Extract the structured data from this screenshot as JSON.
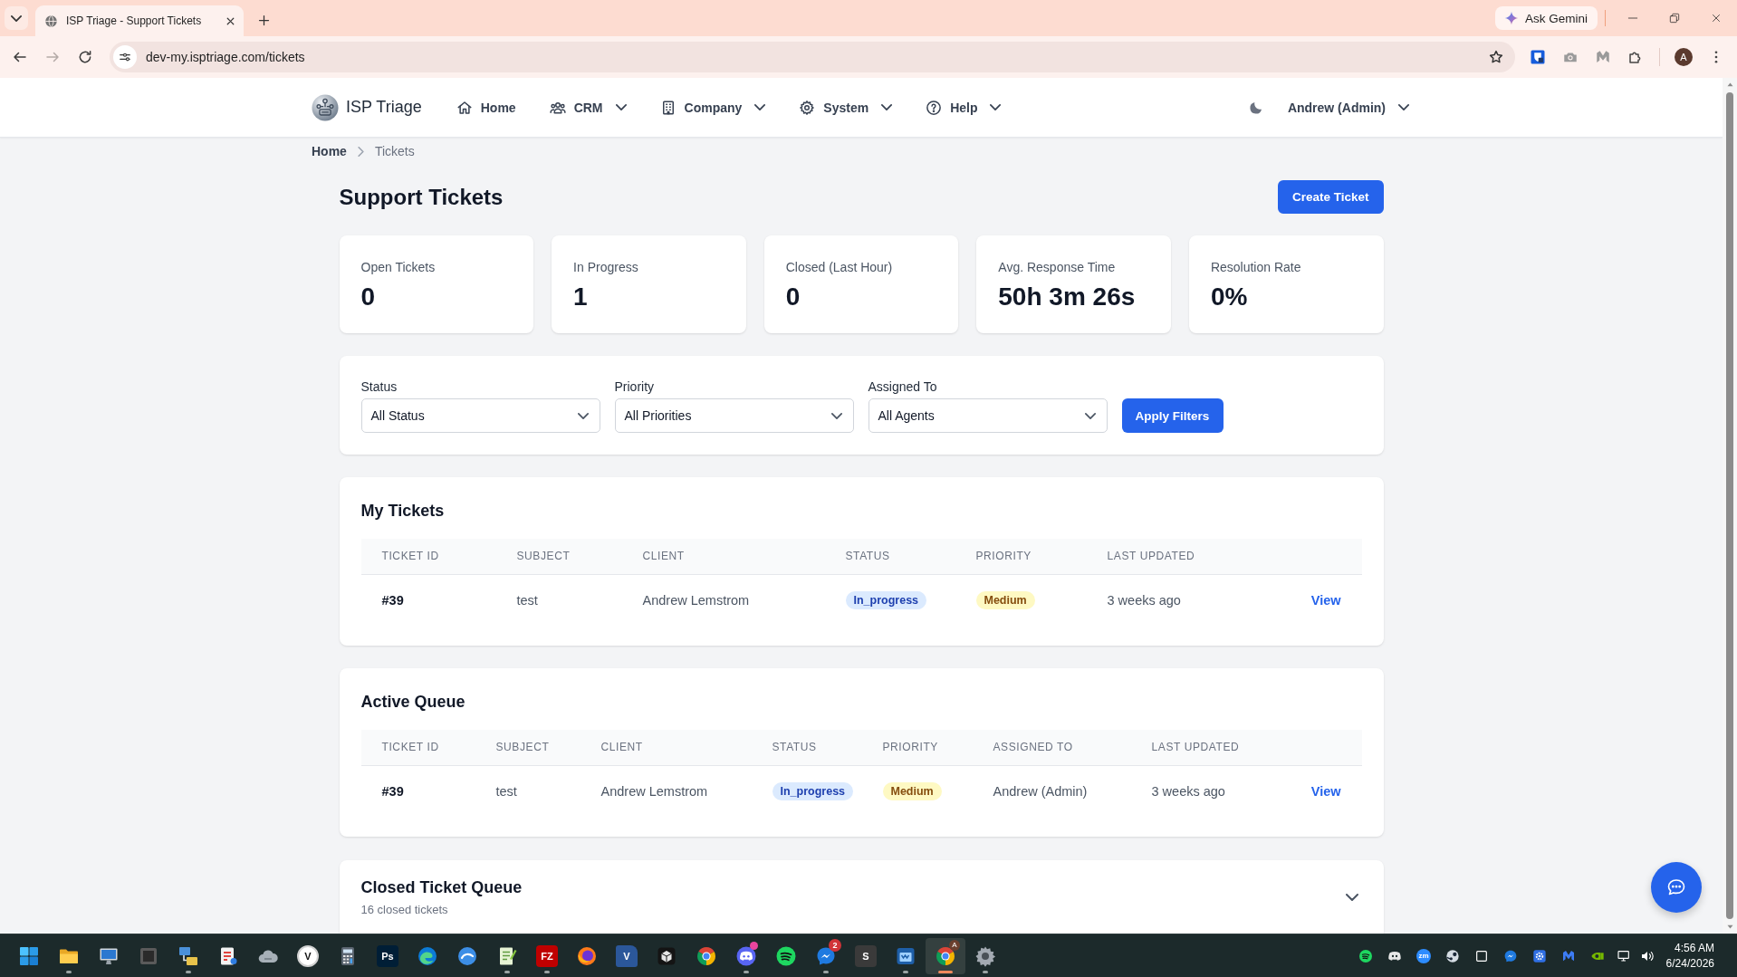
{
  "browser": {
    "tabs": [
      {
        "title": "ISP Triage - Support Tickets",
        "selected": true
      }
    ],
    "gemini_button": "Ask Gemini",
    "back_button": {
      "disabled": false
    },
    "forward_button": {
      "disabled": true
    },
    "url": "dev-my.isptriage.com/tickets",
    "profile_initial": "A"
  },
  "navbar": {
    "brand": "ISP Triage",
    "items": [
      {
        "label": "Home",
        "dropdown": false
      },
      {
        "label": "CRM",
        "dropdown": true
      },
      {
        "label": "Company",
        "dropdown": true
      },
      {
        "label": "System",
        "dropdown": true
      },
      {
        "label": "Help",
        "dropdown": true
      }
    ],
    "user": {
      "label": "Andrew (Admin)",
      "dropdown": true
    }
  },
  "breadcrumb": [
    {
      "label": "Home",
      "current": false
    },
    {
      "label": "Tickets",
      "current": true
    }
  ],
  "header": {
    "title": "Support Tickets",
    "button": "Create Ticket"
  },
  "stats": [
    {
      "label": "Open Tickets",
      "value": "0"
    },
    {
      "label": "In Progress",
      "value": "1"
    },
    {
      "label": "Closed (Last Hour)",
      "value": "0"
    },
    {
      "label": "Avg. Response Time",
      "value": "50h 3m 26s"
    },
    {
      "label": "Resolution Rate",
      "value": "0%"
    }
  ],
  "filters": {
    "fields": [
      {
        "label": "Status",
        "value": "All Status"
      },
      {
        "label": "Priority",
        "value": "All Priorities"
      },
      {
        "label": "Assigned To",
        "value": "All Agents"
      }
    ],
    "button": "Apply Filters"
  },
  "tables": [
    {
      "title": "My Tickets",
      "columns": [
        "TICKET ID",
        "SUBJECT",
        "CLIENT",
        "STATUS",
        "PRIORITY",
        "LAST UPDATED"
      ],
      "rows": [
        {
          "cells": [
            {
              "kind": "id",
              "text": "#39"
            },
            {
              "kind": "text",
              "text": "test"
            },
            {
              "kind": "text",
              "text": "Andrew Lemstrom"
            },
            {
              "kind": "info",
              "text": "In_progress"
            },
            {
              "kind": "warning",
              "text": "Medium"
            },
            {
              "kind": "text",
              "text": "3 weeks ago"
            },
            {
              "kind": "link",
              "text": "View"
            }
          ]
        }
      ]
    },
    {
      "title": "Active Queue",
      "columns": [
        "TICKET ID",
        "SUBJECT",
        "CLIENT",
        "STATUS",
        "PRIORITY",
        "ASSIGNED TO",
        "LAST UPDATED"
      ],
      "rows": [
        {
          "cells": [
            {
              "kind": "id",
              "text": "#39"
            },
            {
              "kind": "text",
              "text": "test"
            },
            {
              "kind": "text",
              "text": "Andrew Lemstrom"
            },
            {
              "kind": "info",
              "text": "In_progress"
            },
            {
              "kind": "warning",
              "text": "Medium"
            },
            {
              "kind": "text",
              "text": "Andrew (Admin)"
            },
            {
              "kind": "text",
              "text": "3 weeks ago"
            },
            {
              "kind": "link",
              "text": "View"
            }
          ]
        }
      ]
    }
  ],
  "closed_queue": {
    "title": "Closed Ticket Queue",
    "subtitle": "16 closed tickets",
    "expanded": false
  },
  "taskbar": {
    "apps": [
      {
        "kind": "start",
        "running": false,
        "selected": false
      },
      {
        "kind": "folder",
        "running": true,
        "selected": false
      },
      {
        "kind": "monitor",
        "running": false,
        "selected": false
      },
      {
        "kind": "square",
        "running": false,
        "selected": false
      },
      {
        "kind": "network",
        "running": true,
        "selected": false
      },
      {
        "kind": "clipboard",
        "running": false,
        "selected": false
      },
      {
        "kind": "stone",
        "running": false,
        "selected": false
      },
      {
        "kind": "disc",
        "glyph": "V",
        "color": "#ffffff",
        "running": false,
        "selected": false
      },
      {
        "kind": "calculator",
        "running": false,
        "selected": false
      },
      {
        "kind": "tile",
        "glyph": "Ps",
        "color": "#001e36",
        "running": false,
        "selected": false
      },
      {
        "kind": "swirl",
        "running": false,
        "selected": false
      },
      {
        "kind": "bluecircle",
        "running": false,
        "selected": false
      },
      {
        "kind": "notepad",
        "running": true,
        "selected": false
      },
      {
        "kind": "tile",
        "glyph": "FZ",
        "color": "#bf0000",
        "running": true,
        "selected": false
      },
      {
        "kind": "fox",
        "running": false,
        "selected": false
      },
      {
        "kind": "doc",
        "glyph": "V",
        "color": "#2b579a",
        "running": false,
        "selected": false
      },
      {
        "kind": "cube",
        "running": false,
        "selected": false
      },
      {
        "kind": "ring",
        "running": false,
        "selected": false
      },
      {
        "kind": "controller",
        "badge": {
          "kind": "dot"
        },
        "running": true,
        "selected": false
      },
      {
        "kind": "waves",
        "running": false,
        "selected": false
      },
      {
        "kind": "bubble",
        "badge": {
          "kind": "count",
          "text": "2"
        },
        "running": true,
        "selected": false
      },
      {
        "kind": "tile",
        "glyph": "S",
        "color": "#3a3a3a",
        "running": false,
        "selected": false
      },
      {
        "kind": "window",
        "running": true,
        "selected": false
      },
      {
        "kind": "ring",
        "badge": {
          "kind": "profile",
          "text": "A"
        },
        "running": true,
        "selected": true
      },
      {
        "kind": "gear",
        "running": true,
        "selected": false
      }
    ],
    "tray": [
      {
        "kind": "waves"
      },
      {
        "kind": "gamepad"
      },
      {
        "kind": "disc",
        "glyph": "zm",
        "color": "#2d8cff"
      },
      {
        "kind": "steam"
      },
      {
        "kind": "outline"
      },
      {
        "kind": "bubble"
      },
      {
        "kind": "cog"
      },
      {
        "kind": "mlogo"
      },
      {
        "kind": "eye"
      },
      {
        "kind": "netmonitor"
      },
      {
        "kind": "speaker"
      }
    ],
    "time": "4:56 AM",
    "date": "6/24/2026"
  }
}
